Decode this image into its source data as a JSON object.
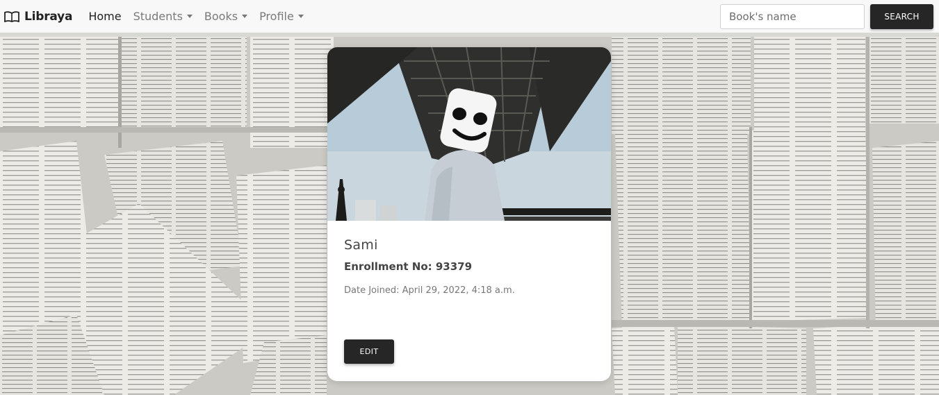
{
  "navbar": {
    "brand": "Libraya",
    "links": [
      {
        "label": "Home",
        "active": true,
        "dropdown": false
      },
      {
        "label": "Students",
        "active": false,
        "dropdown": true
      },
      {
        "label": "Books",
        "active": false,
        "dropdown": true
      },
      {
        "label": "Profile",
        "active": false,
        "dropdown": true
      }
    ],
    "search": {
      "placeholder": "Book's name",
      "button_label": "SEARCH"
    }
  },
  "profile_card": {
    "name": "Sami",
    "enrollment": "Enrollment No: 93379",
    "date_joined": "Date Joined: April 29, 2022, 4:18 a.m.",
    "edit_label": "EDIT"
  },
  "colors": {
    "navbar_bg": "#f8f8f8",
    "button_bg": "#262626",
    "sky": "#b7ccd8"
  },
  "icons": {
    "brand": "open-book-icon",
    "dropdown": "caret-down-icon"
  }
}
